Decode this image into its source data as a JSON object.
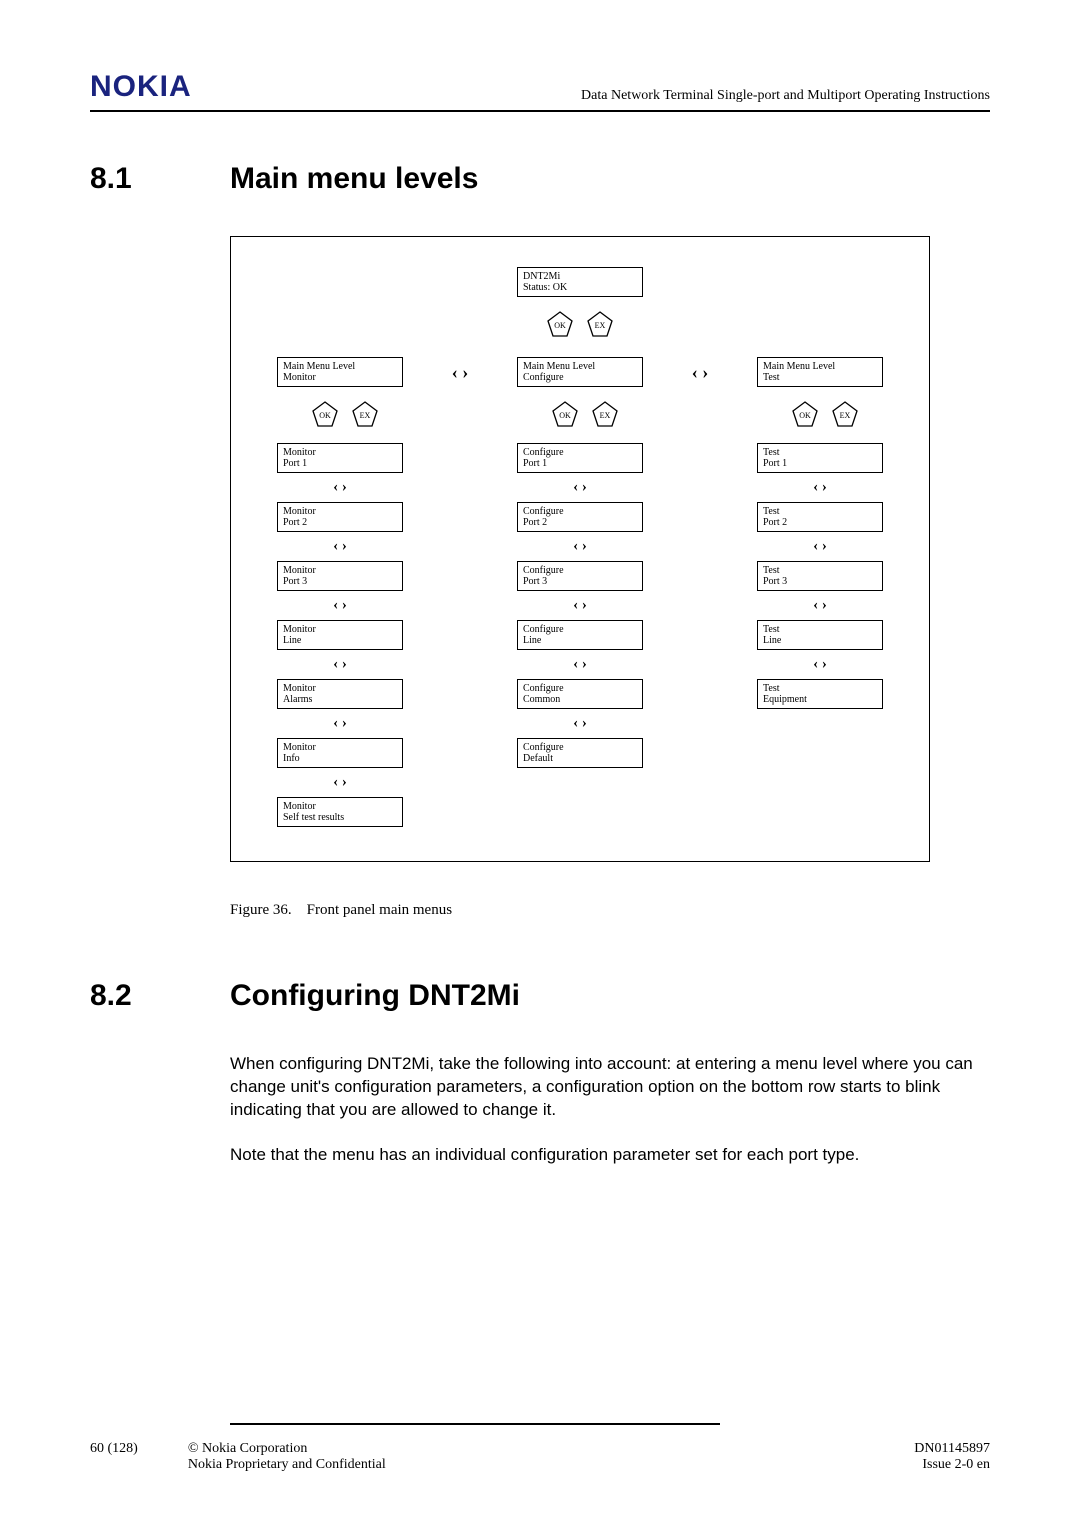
{
  "header": {
    "logo": "NOKIA",
    "doc_title": "Data Network Terminal Single-port and Multiport Operating Instructions"
  },
  "sec81": {
    "num": "8.1",
    "title": "Main menu levels"
  },
  "diagram": {
    "top": {
      "l1": "DNT2Mi",
      "l2": "Status: OK"
    },
    "ok": "OK",
    "ex": "EX",
    "nav": "‹ ›",
    "udarrow": "‹ ›",
    "monitor_head": {
      "l1": "Main Menu Level",
      "l2": "Monitor"
    },
    "configure_head": {
      "l1": "Main Menu Level",
      "l2": "Configure"
    },
    "test_head": {
      "l1": "Main Menu Level",
      "l2": "Test"
    },
    "mon": [
      {
        "l1": "Monitor",
        "l2": "Port 1"
      },
      {
        "l1": "Monitor",
        "l2": "Port 2"
      },
      {
        "l1": "Monitor",
        "l2": "Port 3"
      },
      {
        "l1": "Monitor",
        "l2": "Line"
      },
      {
        "l1": "Monitor",
        "l2": "Alarms"
      },
      {
        "l1": "Monitor",
        "l2": "Info"
      },
      {
        "l1": "Monitor",
        "l2": "Self test results"
      }
    ],
    "cfg": [
      {
        "l1": "Configure",
        "l2": "Port 1"
      },
      {
        "l1": "Configure",
        "l2": "Port 2"
      },
      {
        "l1": "Configure",
        "l2": "Port 3"
      },
      {
        "l1": "Configure",
        "l2": "Line"
      },
      {
        "l1": "Configure",
        "l2": "Common"
      },
      {
        "l1": "Configure",
        "l2": "Default"
      }
    ],
    "tst": [
      {
        "l1": "Test",
        "l2": "Port 1"
      },
      {
        "l1": "Test",
        "l2": "Port 2"
      },
      {
        "l1": "Test",
        "l2": "Port 3"
      },
      {
        "l1": "Test",
        "l2": "Line"
      },
      {
        "l1": "Test",
        "l2": "Equipment"
      }
    ]
  },
  "fig_caption": "Figure 36. Front panel main menus",
  "sec82": {
    "num": "8.2",
    "title": "Configuring DNT2Mi"
  },
  "para1": "When configuring DNT2Mi, take the following into account: at entering a menu level where you can change unit's configuration parameters, a configuration option on the bottom row starts to blink indicating that you are allowed to change it.",
  "para2": "Note that the menu has an individual configuration parameter set for each port type.",
  "footer": {
    "page": "60 (128)",
    "copyright": "© Nokia Corporation",
    "prop": "Nokia Proprietary and Confidential",
    "docid": "DN01145897",
    "issue": "Issue 2-0 en"
  }
}
